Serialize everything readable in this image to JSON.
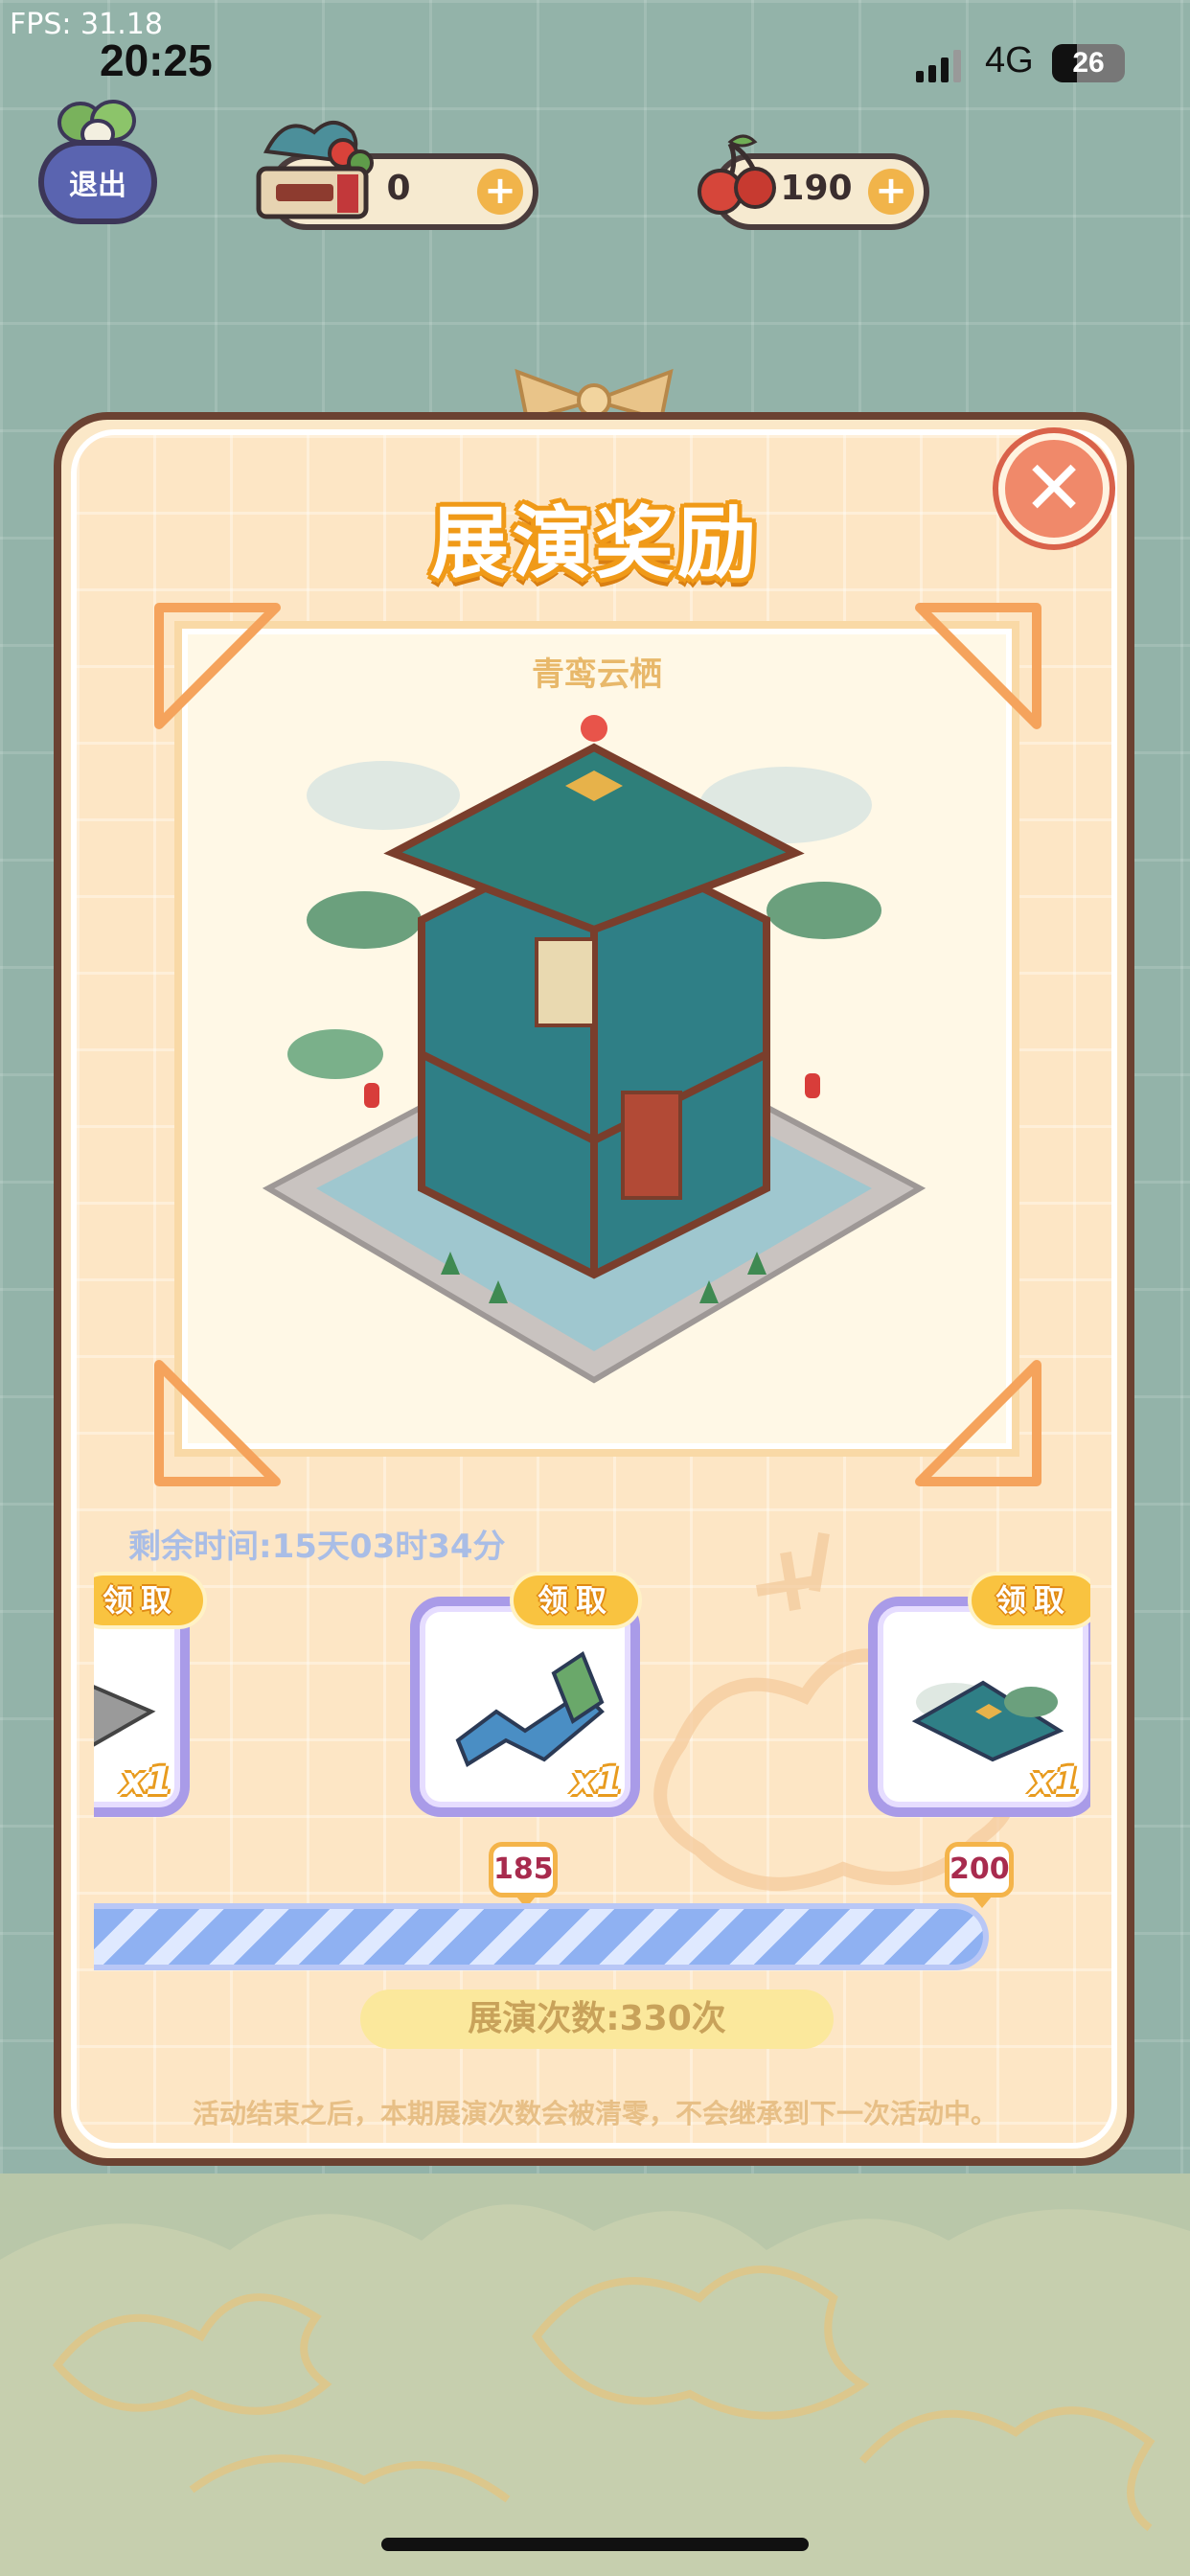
{
  "status_bar": {
    "fps": "FPS: 31.18",
    "time": "20:25",
    "network": "4G",
    "battery": "26"
  },
  "hud": {
    "exit_label": "退出",
    "currency_1": {
      "icon": "ticket-bundle-icon",
      "value": "0"
    },
    "currency_2": {
      "icon": "cherry-icon",
      "value": "190"
    }
  },
  "panel": {
    "title": "展演奖励",
    "close_icon": "close-icon",
    "building_name": "青鸾云栖",
    "remaining_time": "剩余时间:15天03时34分",
    "rewards": [
      {
        "claim_label": "领取",
        "count": "x1",
        "icon": "floor-tile-icon"
      },
      {
        "claim_label": "领取",
        "count": "x1",
        "icon": "waterfall-rock-icon"
      },
      {
        "claim_label": "领取",
        "count": "x1",
        "icon": "green-roof-icon"
      }
    ],
    "milestones": [
      "185",
      "200"
    ],
    "progress_fraction": 1.0,
    "performance_count": "展演次数:330次",
    "notice": "活动结束之后，本期展演次数会被清零，不会继承到下一次活动中。"
  },
  "colors": {
    "panel_border": "#6b4232",
    "title_orange": "#f09a18",
    "card_border": "#a99be8",
    "progress_fill": "#8fb1f2"
  }
}
